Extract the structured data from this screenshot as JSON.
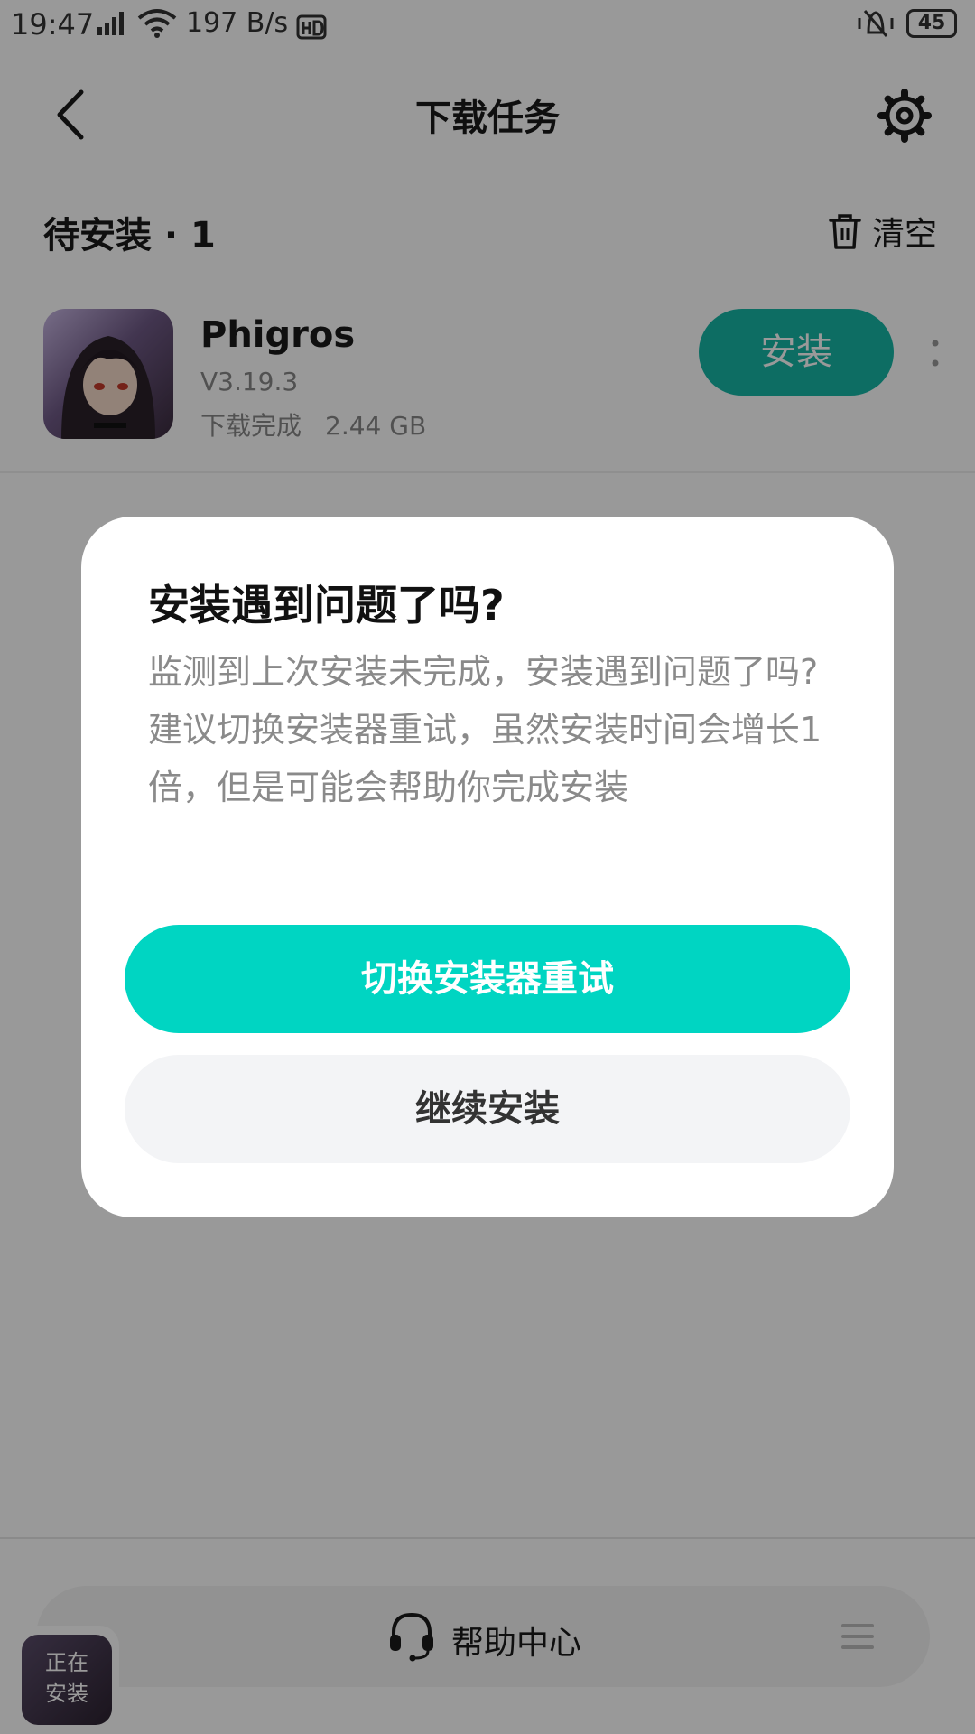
{
  "status_bar": {
    "time": "19:47",
    "network_speed": "197 B/s",
    "battery": "45"
  },
  "header": {
    "title": "下载任务"
  },
  "section": {
    "title": "待安装 · 1",
    "clear_label": "清空"
  },
  "app": {
    "name": "Phigros",
    "version": "V3.19.3",
    "status": "下载完成",
    "size": "2.44 GB",
    "install_label": "安装"
  },
  "bottom": {
    "help_label": "帮助中心",
    "float_line1": "正在",
    "float_line2": "安装"
  },
  "dialog": {
    "title": "安装遇到问题了吗?",
    "body_line1": "监测到上次安装未完成，安装遇到问题了吗?",
    "body_line2": "建议切换安装器重试，虽然安装时间会增长1倍，但是可能会帮助你完成安装",
    "primary_label": "切换安装器重试",
    "secondary_label": "继续安装"
  },
  "colors": {
    "accent": "#00d5c2",
    "install_button": "#16b6a6",
    "overlay": "rgba(0,0,0,0.40)"
  }
}
